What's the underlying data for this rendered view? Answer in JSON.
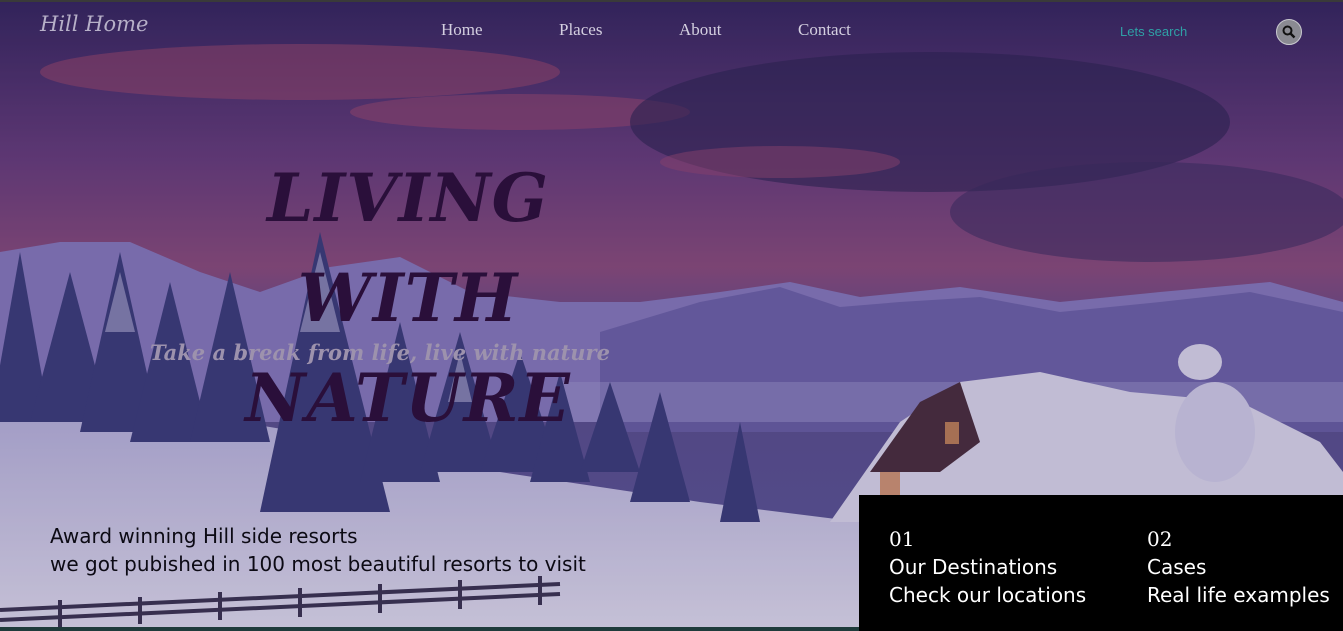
{
  "brand": "Hill Home",
  "nav": [
    {
      "label": "Home"
    },
    {
      "label": "Places"
    },
    {
      "label": "About"
    },
    {
      "label": "Contact"
    }
  ],
  "search": {
    "text": "Lets search",
    "icon": "search-icon"
  },
  "hero": {
    "headline_line1": "LIVING WITH",
    "headline_line2": "NATURE",
    "tagline": "Take a break from life, live with nature"
  },
  "award": {
    "line1": "Award winning Hill side resorts",
    "line2": "we got pubished in 100 most beautiful resorts to visit"
  },
  "cards": [
    {
      "number": "01",
      "title": "Our Destinations",
      "subtitle": "Check our locations"
    },
    {
      "number": "02",
      "title": "Cases",
      "subtitle": "Real life examples"
    }
  ],
  "colors": {
    "panel": "#000000",
    "search_text": "#2fa0a6",
    "headline": "#2a0f3a"
  }
}
